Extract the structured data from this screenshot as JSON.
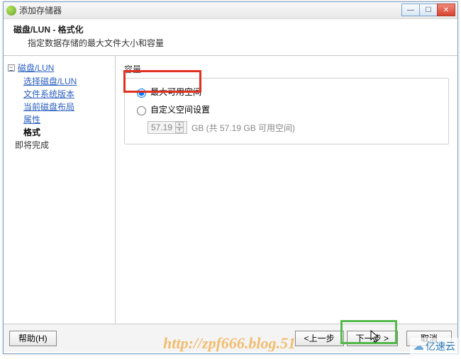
{
  "window": {
    "title": "添加存储器"
  },
  "header": {
    "title": "磁盘/LUN - 格式化",
    "subtitle": "指定数据存储的最大文件大小和容量"
  },
  "sidebar": {
    "root": "磁盘/LUN",
    "items": [
      "选择磁盘/LUN",
      "文件系统版本",
      "当前磁盘布局",
      "属性"
    ],
    "current": "格式",
    "last": "即将完成"
  },
  "main": {
    "section_label": "容量",
    "radio_max": "最大可用空间",
    "radio_custom": "自定义空间设置",
    "custom_value": "57.19",
    "custom_suffix": "GB (共 57.19 GB 可用空间)"
  },
  "footer": {
    "help": "帮助(H)",
    "back": "<上一步",
    "next": "下一步 >",
    "cancel": "取消"
  },
  "watermark": "http://zpf666.blog.51",
  "corner_brand": "亿速云"
}
